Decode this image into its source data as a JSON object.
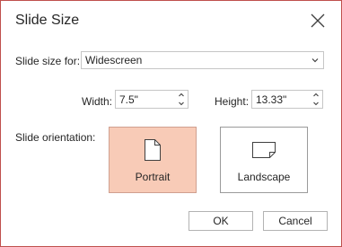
{
  "dialog": {
    "title": "Slide Size",
    "close_icon": "close-icon"
  },
  "slide_size_for": {
    "label": "Slide size for:",
    "value": "Widescreen",
    "icon": "chevron-down-icon"
  },
  "width": {
    "label": "Width:",
    "value": "7.5\""
  },
  "height": {
    "label": "Height:",
    "value": "13.33\""
  },
  "orientation": {
    "label": "Slide orientation:",
    "options": [
      {
        "label": "Portrait",
        "icon": "portrait-page-icon",
        "selected": true
      },
      {
        "label": "Landscape",
        "icon": "landscape-page-icon",
        "selected": false
      }
    ],
    "selected_color": "#f8cbb7"
  },
  "buttons": {
    "ok_label": "OK",
    "cancel_label": "Cancel"
  },
  "colors": {
    "dialog_border": "#c0504d"
  }
}
